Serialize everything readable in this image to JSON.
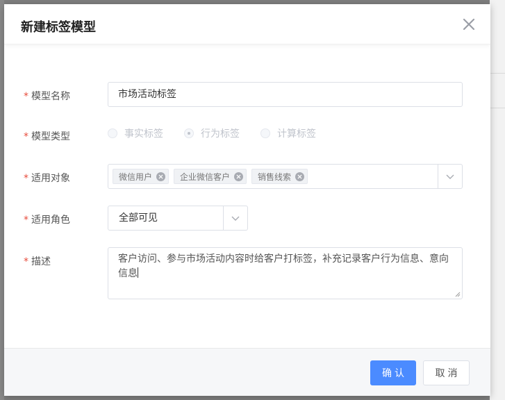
{
  "dialog": {
    "title": "新建标签模型"
  },
  "form": {
    "name": {
      "label": "模型名称",
      "value": "市场活动标签"
    },
    "type": {
      "label": "模型类型",
      "options": [
        "事实标签",
        "行为标签",
        "计算标签"
      ],
      "selected": "行为标签"
    },
    "target": {
      "label": "适用对象",
      "tags": [
        "微信用户",
        "企业微信客户",
        "销售线索"
      ]
    },
    "role": {
      "label": "适用角色",
      "value": "全部可见"
    },
    "description": {
      "label": "描述",
      "value": "客户访问、参与市场活动内容时给客户打标签，补充记录客户行为信息、意向信息"
    }
  },
  "footer": {
    "confirm_label": "确认",
    "cancel_label": "取消"
  },
  "colors": {
    "primary": "#4b8bff",
    "required": "#e74c3c"
  }
}
